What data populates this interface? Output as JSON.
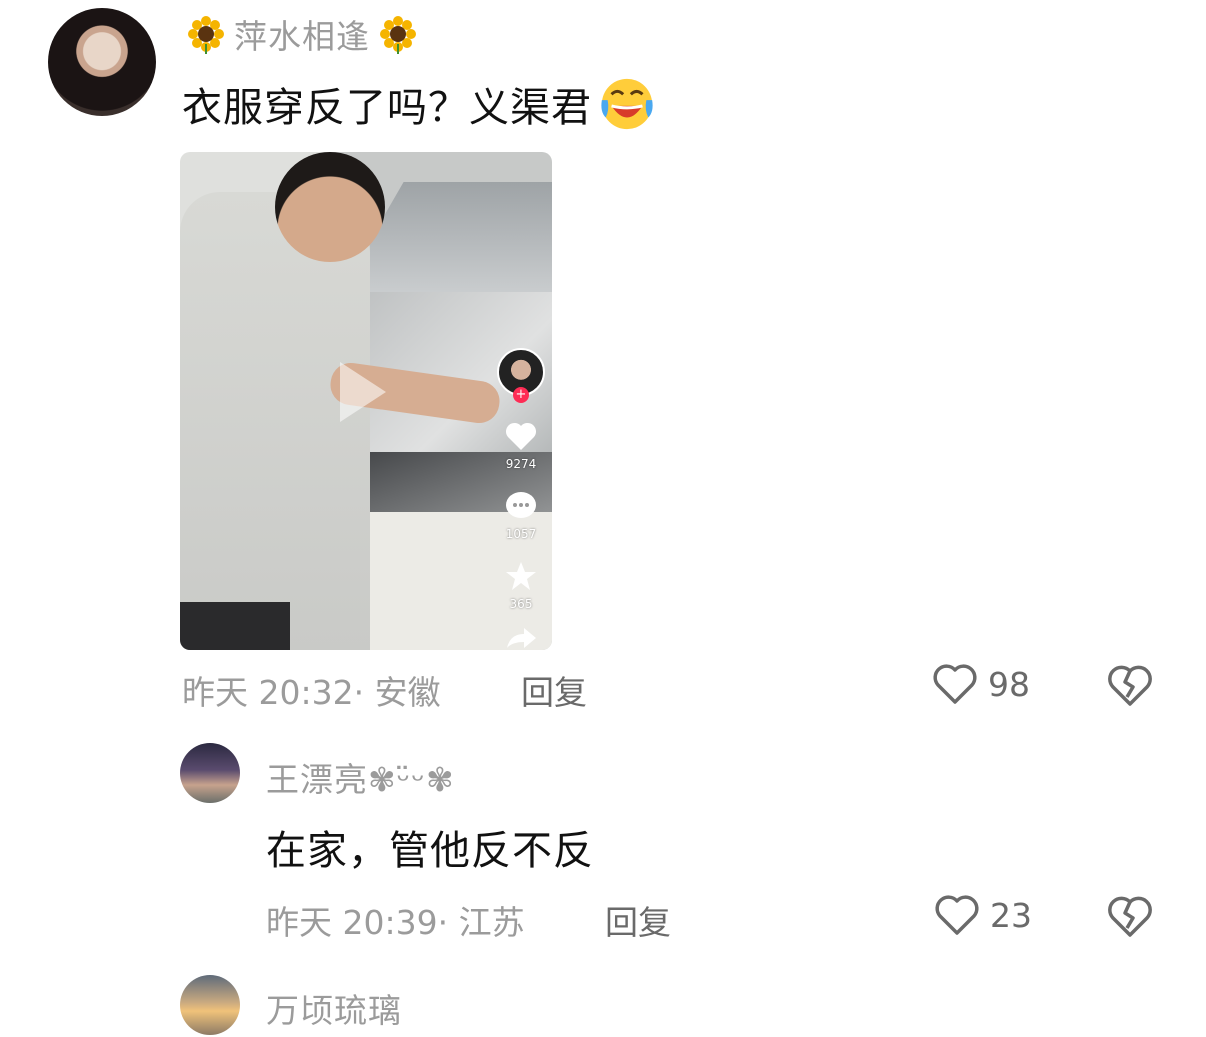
{
  "comment": {
    "username": "萍水相逢",
    "text": "衣服穿反了吗？义渠君",
    "username_decor_icon": "sunflower-icon",
    "text_emoji_icon": "laughing-tears-icon",
    "video": {
      "likes": "9274",
      "comments": "1057",
      "favorites": "365"
    },
    "time_location": "昨天 20:32· 安徽",
    "reply_label": "回复",
    "like_count": "98"
  },
  "reply": {
    "username": "王漂亮✾ᵕ̈ᵕ✾",
    "text": "在家，管他反不反",
    "time_location": "昨天 20:39· 江苏",
    "reply_label": "回复",
    "like_count": "23"
  },
  "next_comment": {
    "username": "万顷琉璃"
  },
  "colors": {
    "muted_text": "#9b9b9b",
    "primary_text": "#111111",
    "icon_gray": "#6a6a6a"
  }
}
